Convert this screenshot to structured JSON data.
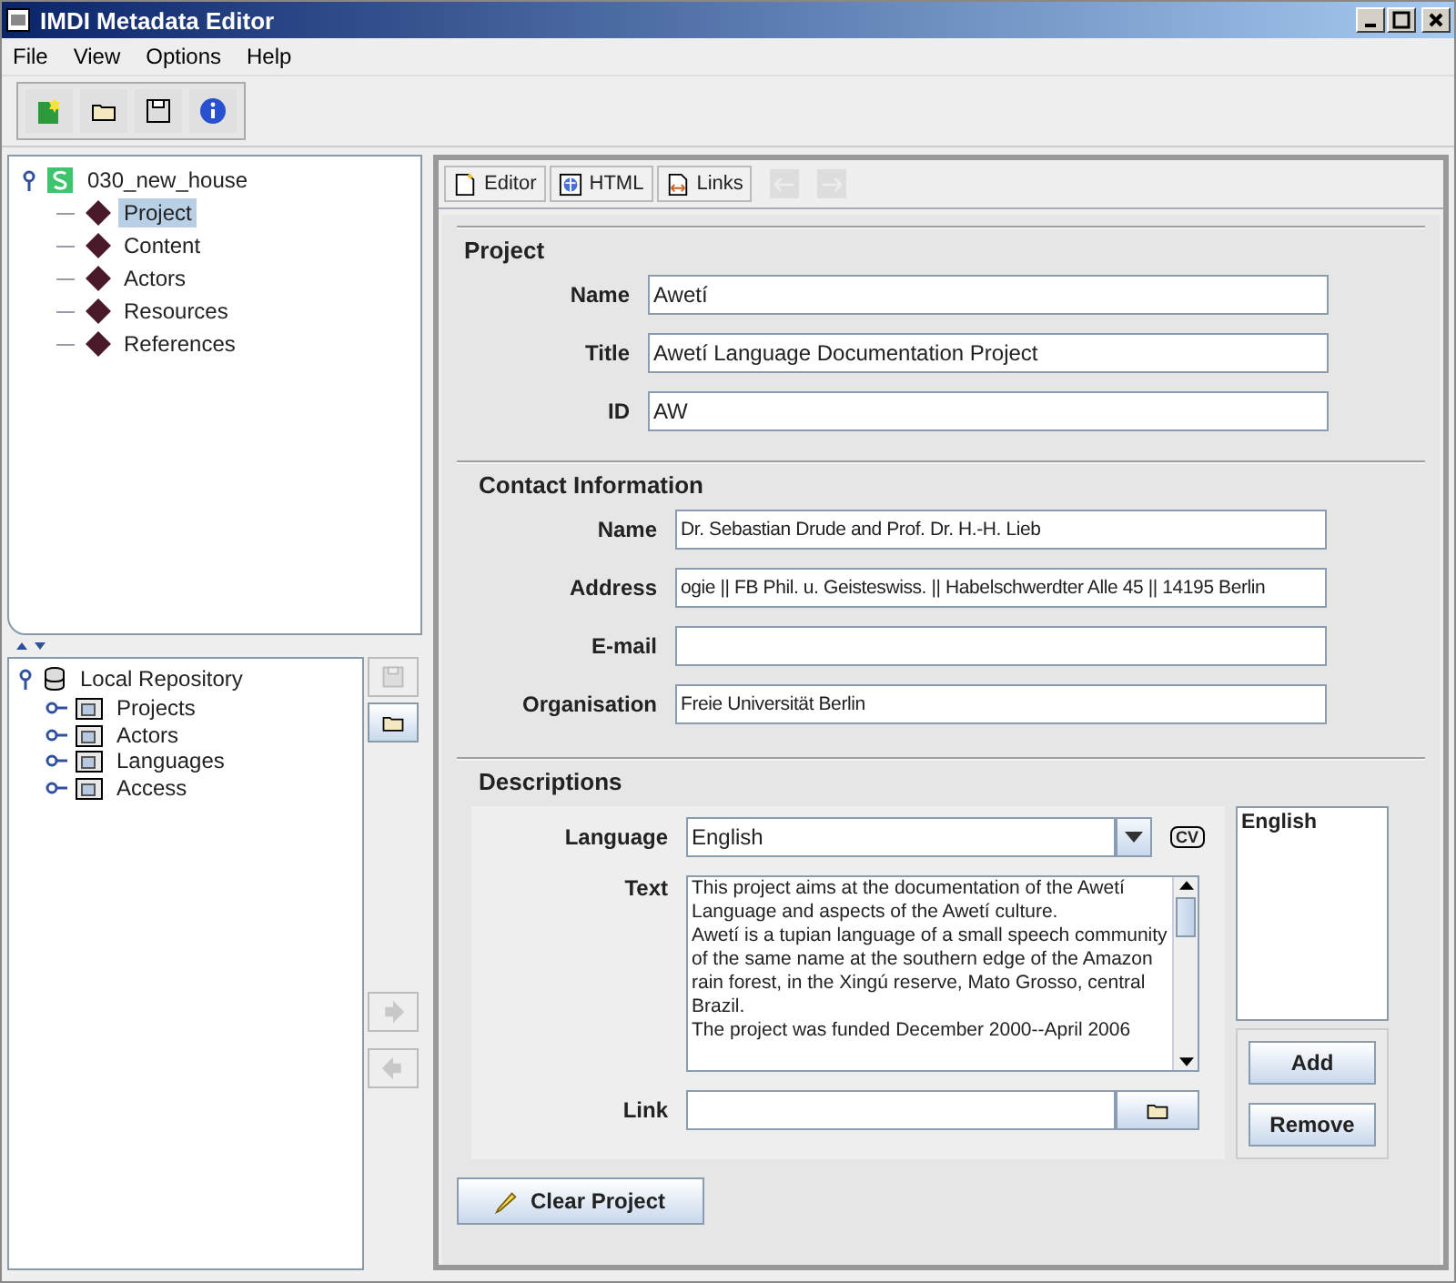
{
  "window": {
    "title": "IMDI Metadata Editor"
  },
  "menu": [
    "File",
    "View",
    "Options",
    "Help"
  ],
  "session_tree": {
    "label": "030_new_house",
    "expanded": true,
    "children": [
      {
        "label": "Project",
        "selected": true
      },
      {
        "label": "Content",
        "selected": false
      },
      {
        "label": "Actors",
        "selected": false
      },
      {
        "label": "Resources",
        "selected": false
      },
      {
        "label": "References",
        "selected": false
      }
    ]
  },
  "repository_tree": {
    "label": "Local Repository",
    "expanded": true,
    "children": [
      {
        "label": "Projects",
        "expanded": false
      },
      {
        "label": "Actors",
        "expanded": false
      },
      {
        "label": "Languages",
        "expanded": false
      },
      {
        "label": "Access",
        "expanded": false
      }
    ]
  },
  "tabs": [
    "Editor",
    "HTML",
    "Links"
  ],
  "project": {
    "heading": "Project",
    "fields": [
      {
        "label": "Name",
        "value": "Awetí"
      },
      {
        "label": "Title",
        "value": "Awetí Language Documentation Project"
      },
      {
        "label": "ID",
        "value": "AW"
      }
    ]
  },
  "contact": {
    "heading": "Contact Information",
    "fields": [
      {
        "label": "Name",
        "value": "Dr. Sebastian Drude and Prof. Dr. H.-H. Lieb"
      },
      {
        "label": "Address",
        "value": "ogie || FB Phil. u. Geisteswiss. || Habelschwerdter Alle 45 || 14195 Berlin"
      },
      {
        "label": "E-mail"
      },
      {
        "label": "Organisation",
        "value": "Freie Universität Berlin"
      }
    ]
  },
  "descriptions": {
    "heading": "Descriptions",
    "language_label": "Language",
    "language": "English",
    "cv": "CV",
    "text_label": "Text",
    "text": "This project aims at the documentation of the Awetí Language and aspects of the Awetí culture.\nAwetí is a tupian language of a small speech community of the same name at the southern edge of the Amazon rain forest, in the Xingú reserve, Mato Grosso, central Brazil.\nThe project was funded December 2000--April 2006",
    "link_label": "Link",
    "list": [
      "English"
    ],
    "buttons": [
      "Add",
      "Remove"
    ]
  },
  "clear_button": "Clear Project"
}
